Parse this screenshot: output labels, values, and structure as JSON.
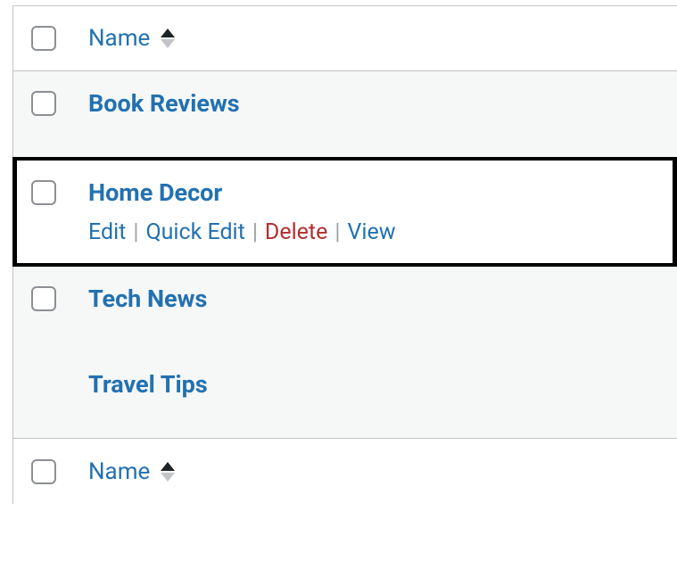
{
  "columns": {
    "name_label": "Name"
  },
  "rows": [
    {
      "title": "Book Reviews",
      "has_checkbox": true,
      "hovered": false
    },
    {
      "title": "Home Decor",
      "has_checkbox": true,
      "hovered": true
    },
    {
      "title": "Tech News",
      "has_checkbox": true,
      "hovered": false
    },
    {
      "title": "Travel Tips",
      "has_checkbox": false,
      "hovered": false
    }
  ],
  "row_actions": {
    "edit": "Edit",
    "quick_edit": "Quick Edit",
    "delete": "Delete",
    "view": "View"
  }
}
